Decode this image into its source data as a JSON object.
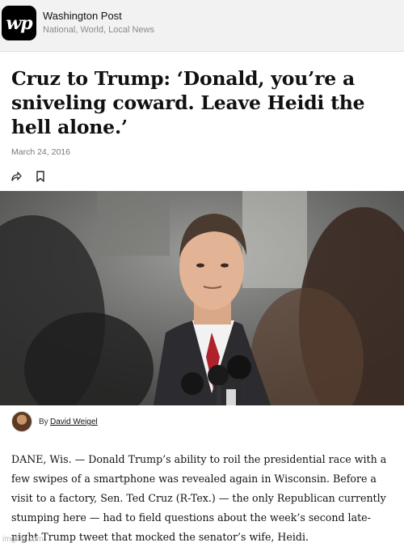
{
  "app": {
    "logo_text": "wp",
    "name": "Washington Post",
    "subtitle": "National, World, Local News"
  },
  "article": {
    "headline": "Cruz to Trump: ‘Donald, you’re a sniveling coward. Leave Heidi the hell alone.’",
    "date": "March 24, 2016",
    "byline_prefix": "By",
    "author": "David Weigel",
    "body": "DANE, Wis. — Donald Trump’s ability to roil the presidential race with a few swipes of a smartphone was revealed again in Wisconsin. Before a visit to a factory, Sen. Ted Cruz (R-Tex.) — the only Republican currently stumping here — had to field questions about the week’s second late-night Trump tweet that mocked the senator’s wife, Heidi."
  },
  "icons": {
    "share": "share-icon",
    "bookmark": "bookmark-icon"
  },
  "watermark": "imgflip.com"
}
